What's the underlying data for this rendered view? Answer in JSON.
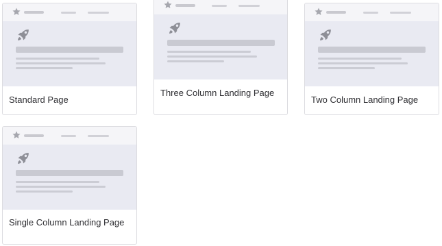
{
  "templates": [
    {
      "label": "Standard Page"
    },
    {
      "label": "Three Column Landing Page"
    },
    {
      "label": "Two Column Landing Page"
    },
    {
      "label": "Single Column Landing Page"
    }
  ],
  "colors": {
    "thumb_background": "#e9eaf2",
    "thumb_header": "#f5f5f8",
    "placeholder_line": "#c9cad2",
    "icon_gray": "#9a9ba3",
    "text": "#2f2f33"
  }
}
